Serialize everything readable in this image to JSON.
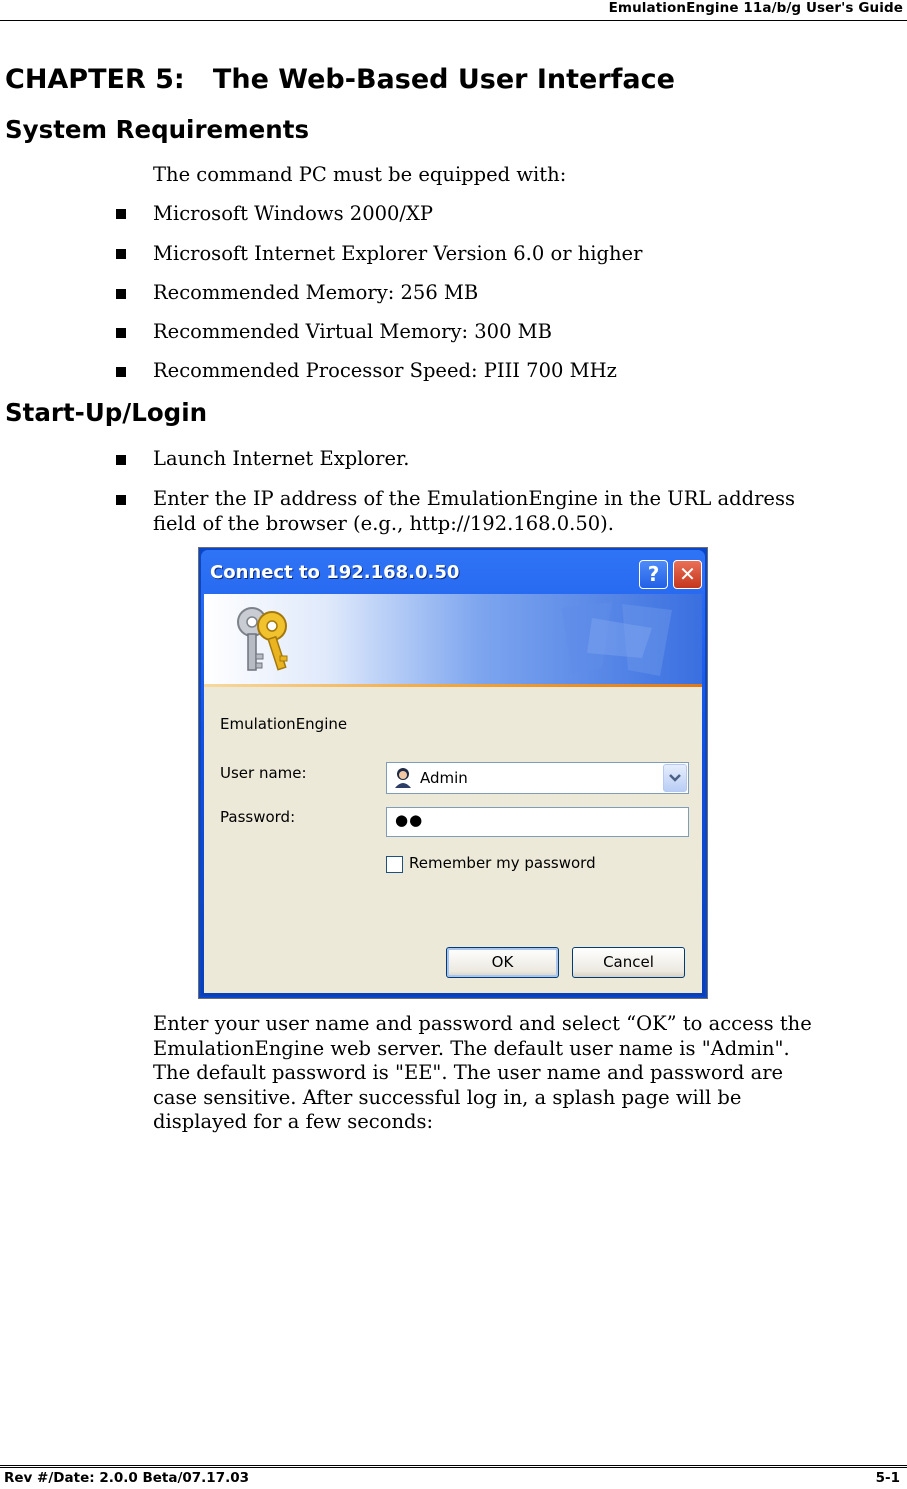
{
  "header": {
    "title": "EmulationEngine 11a/b/g User's Guide"
  },
  "chapter_title": "CHAPTER 5:   The Web-Based User Interface",
  "system_requirements": {
    "heading": "System Requirements",
    "intro": "The command PC must be equipped with:",
    "items": [
      "Microsoft Windows 2000/XP",
      "Microsoft Internet Explorer Version 6.0 or higher",
      "Recommended Memory: 256 MB",
      "Recommended Virtual Memory: 300 MB",
      "Recommended Processor Speed: PIII 700 MHz"
    ]
  },
  "startup": {
    "heading": "Start-Up/Login",
    "items": [
      "Launch Internet Explorer.",
      "Enter the IP address of the EmulationEngine in the URL address",
      "field of the browser (e.g., http://192.168.0.50)."
    ],
    "after_text": [
      "Enter your user name and password and select “OK” to access the",
      "EmulationEngine web server. The default user name is \"Admin\".",
      "The default password is \"EE\". The user name and password are",
      "case sensitive. After successful log in, a splash page will be",
      "displayed for a few seconds:"
    ]
  },
  "dialog": {
    "title": "Connect to 192.168.0.50",
    "help_label": "?",
    "close_label": "✕",
    "realm": "EmulationEngine",
    "user_label": "User name:",
    "user_value": "Admin",
    "password_label": "Password:",
    "password_value": "●●",
    "remember_label": "Remember my password",
    "ok_label": "OK",
    "cancel_label": "Cancel"
  },
  "footer": {
    "left": "Rev #/Date: 2.0.0 Beta/07.17.03",
    "right": "5-1"
  }
}
